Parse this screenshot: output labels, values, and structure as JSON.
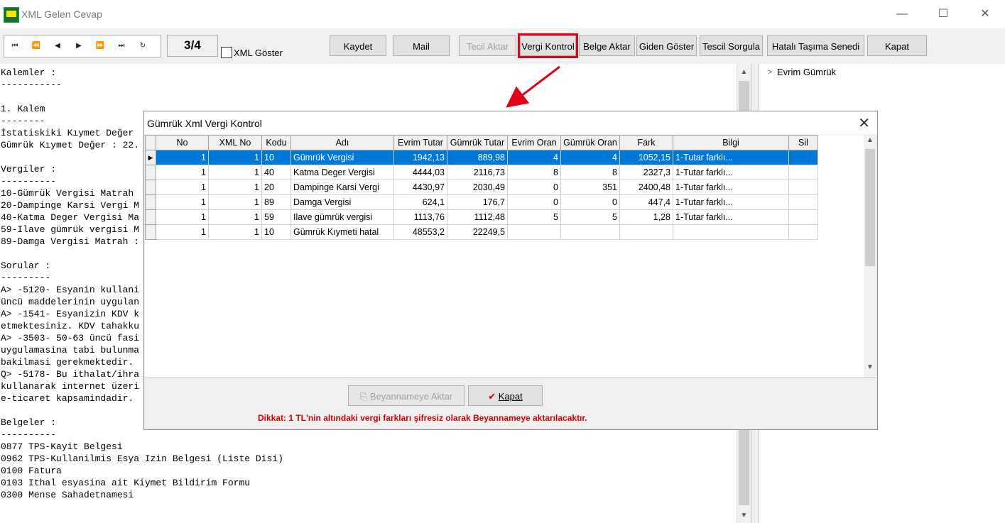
{
  "window": {
    "title": "XML Gelen Cevap"
  },
  "toolbar": {
    "nav_icons": [
      "first-icon",
      "prev-page-icon",
      "prev-icon",
      "next-icon",
      "next-page-icon",
      "last-icon",
      "refresh-icon"
    ],
    "counter": "3/4",
    "xml_goster": "XML Göster",
    "buttons": {
      "kaydet": "Kaydet",
      "mail": "Mail",
      "tecil_aktar": "Tecil Aktar",
      "vergi_kontrol": "Vergi Kontrol",
      "belge_aktar": "Belge Aktar",
      "giden_goster": "Giden Göster",
      "tescil_sorgula": "Tescil Sorgula",
      "hatali_tasima": "Hatalı Taşıma Senedi",
      "kapat": "Kapat"
    },
    "highlight_color": "#e0001a"
  },
  "left_text": [
    "Kalemler :",
    "-----------",
    "",
    "1. Kalem",
    "--------",
    "İstatiskiki Kıymet Değer",
    "Gümrük Kıymet Değer : 22.",
    "",
    "Vergiler :",
    "----------",
    "10-Gümrük Vergisi Matrah",
    "20-Dampinge Karsi Vergi M",
    "40-Katma Deger Vergisi Ma",
    "59-Ilave gümrük vergisi M",
    "89-Damga Vergisi Matrah :",
    "",
    "Sorular :",
    "---------",
    "A> -5120- Esyanin kullani",
    "üncü maddelerinin uygulan",
    "A> -1541- Esyanizin KDV k",
    "etmektesiniz. KDV tahakku",
    "A> -3503- 50-63 üncü fasi",
    "uygulamasina tabi bulunma",
    "bakilmasi gerekmektedir.",
    "Q> -5178- Bu ithalat/ihra",
    "kullanarak internet üzeri",
    "e-ticaret kapsamindadir.",
    "",
    "Belgeler :",
    "----------",
    "0877 TPS-Kayit Belgesi",
    "0962 TPS-Kullanilmis Esya Izin Belgesi (Liste Disi)",
    "0100 Fatura",
    "0103 Ithal esyasina ait Kiymet Bildirim Formu",
    "0300 Mense Sahadetnamesi"
  ],
  "tree": {
    "item": "Evrim Gümrük"
  },
  "dialog": {
    "title": "Gümrük Xml Vergi Kontrol",
    "columns": [
      "No",
      "XML No",
      "Kodu",
      "Adı",
      "Evrim Tutar",
      "Gümrük Tutar",
      "Evrim Oran",
      "Gümrük Oran",
      "Fark",
      "Bilgi",
      "Sil"
    ],
    "rows": [
      [
        "1",
        "1",
        "10",
        "Gümrük Vergisi",
        "1942,13",
        "889,98",
        "4",
        "4",
        "1052,15",
        "1-Tutar farklı...",
        ""
      ],
      [
        "1",
        "1",
        "40",
        "Katma Deger Vergisi",
        "4444,03",
        "2116,73",
        "8",
        "8",
        "2327,3",
        "1-Tutar farklı...",
        ""
      ],
      [
        "1",
        "1",
        "20",
        "Dampinge Karsi Vergi",
        "4430,97",
        "2030,49",
        "0",
        "351",
        "2400,48",
        "1-Tutar farklı...",
        ""
      ],
      [
        "1",
        "1",
        "89",
        "Damga Vergisi",
        "624,1",
        "176,7",
        "0",
        "0",
        "447,4",
        "1-Tutar farklı...",
        ""
      ],
      [
        "1",
        "1",
        "59",
        "Ilave gümrük vergisi",
        "1113,76",
        "1112,48",
        "5",
        "5",
        "1,28",
        "1-Tutar farklı...",
        ""
      ],
      [
        "1",
        "1",
        "10",
        "Gümrük Kıymeti hatal",
        "48553,2",
        "22249,5",
        "",
        "",
        "",
        "",
        ""
      ]
    ],
    "selected_row": 0,
    "buttons": {
      "beyannameye_aktar": "Beyannameye Aktar",
      "kapat": "Kapat"
    },
    "warning": "Dikkat: 1 TL'nin altındaki vergi farkları şifresiz olarak Beyannameye aktarılacaktır."
  }
}
